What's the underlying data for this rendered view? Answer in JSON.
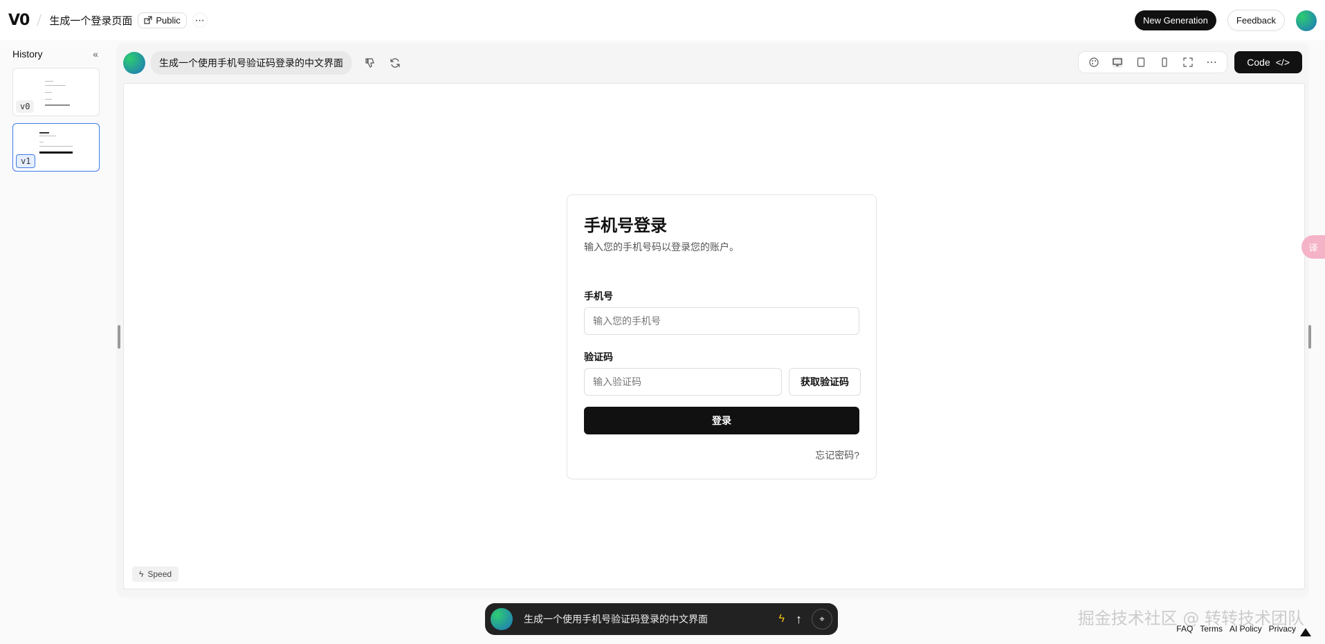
{
  "topbar": {
    "logo": "V0",
    "project_title": "生成一个登录页面",
    "visibility": "Public",
    "more": "⋯",
    "new_generation": "New Generation",
    "feedback": "Feedback"
  },
  "history": {
    "title": "History",
    "versions": [
      {
        "label": "v0",
        "active": false
      },
      {
        "label": "v1",
        "active": true
      }
    ]
  },
  "main": {
    "prompt": "生成一个使用手机号验证码登录的中文界面",
    "code_button": "Code",
    "speed": "Speed"
  },
  "login_card": {
    "title": "手机号登录",
    "subtitle": "输入您的手机号码以登录您的账户。",
    "phone_label": "手机号",
    "phone_placeholder": "输入您的手机号",
    "code_label": "验证码",
    "code_placeholder": "输入验证码",
    "get_code": "获取验证码",
    "login": "登录",
    "forgot": "忘记密码?"
  },
  "bottom_bar": {
    "prompt": "生成一个使用手机号验证码登录的中文界面"
  },
  "footer": {
    "links": [
      "FAQ",
      "Terms",
      "AI Policy",
      "Privacy"
    ]
  },
  "watermark": "掘金技术社区 @ 转转技术团队",
  "translate_chip": "译"
}
